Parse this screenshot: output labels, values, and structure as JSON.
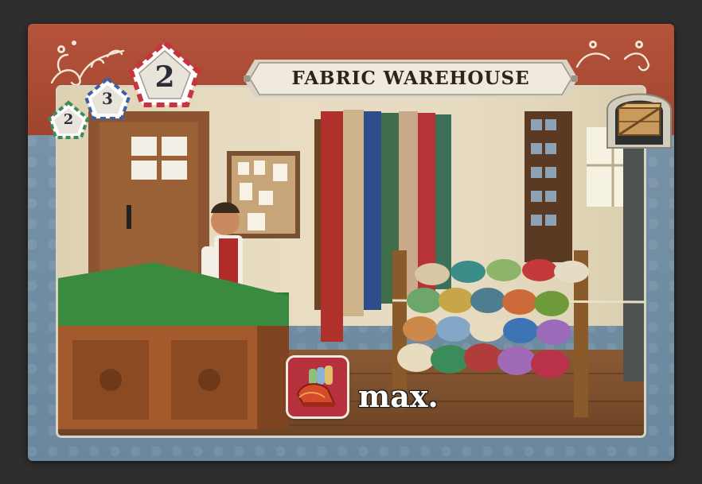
{
  "card": {
    "title": "FABRIC WAREHOUSE",
    "level_badge_large": "2",
    "level_badge_mid": "3",
    "level_badge_small": "2",
    "production_label": "max."
  },
  "icons": {
    "warehouse": "crate-icon",
    "resource": "fabric-bolt-icon"
  },
  "colors": {
    "frame_top": "#a84a33",
    "frame_bottom": "#6c8aa0",
    "title_plate": "#e8e3d6",
    "resource_tile": "#b7303d"
  }
}
